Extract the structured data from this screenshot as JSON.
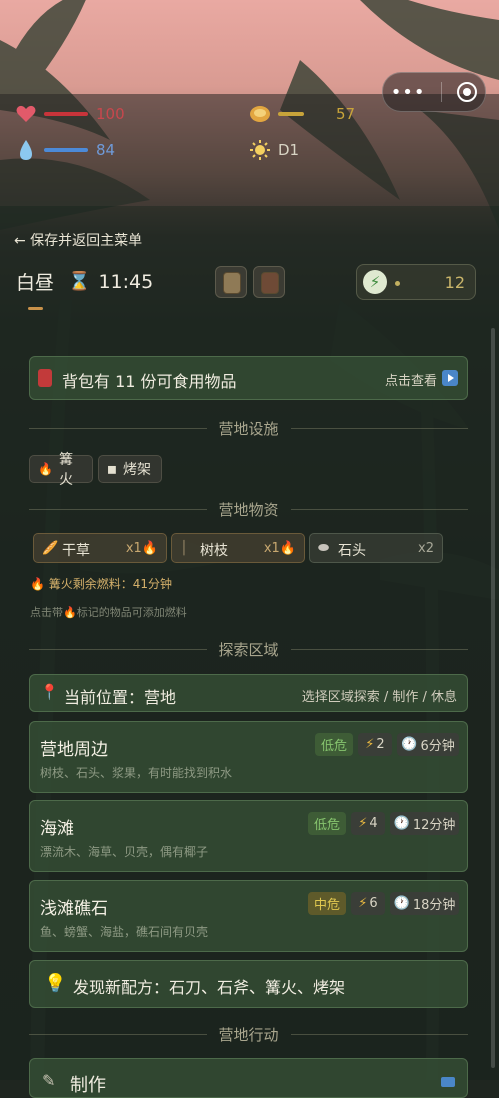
{
  "hud": {
    "health": {
      "icon": "heart-icon",
      "value": "100",
      "level": 1.0,
      "color": "#c8343a"
    },
    "water": {
      "icon": "water-drop-icon",
      "value": "84",
      "level": 0.84,
      "color": "#4c8ad8"
    },
    "food": {
      "icon": "bread-icon",
      "value": "57",
      "level": 0.57,
      "color": "#c8a43a"
    },
    "day": {
      "icon": "sun-icon",
      "value": "D1"
    }
  },
  "header": {
    "back_label": "← 保存并返回主菜单",
    "period": "白昼",
    "time": "11:45",
    "energy": "12"
  },
  "food_banner": {
    "text": "背包有 11 份可食用物品",
    "action": "点击查看"
  },
  "facilities": {
    "title": "营地设施",
    "items": [
      {
        "label": "篝火",
        "icon": "fire-icon"
      },
      {
        "label": "烤架",
        "icon": "grill-icon"
      }
    ]
  },
  "materials": {
    "title": "营地物资",
    "items": [
      {
        "name": "干草",
        "qty": "x1🔥",
        "icon": "hay-icon"
      },
      {
        "name": "树枝",
        "qty": "x1🔥",
        "icon": "stick-icon"
      },
      {
        "name": "石头",
        "qty": "x2",
        "icon": "stone-icon"
      }
    ],
    "fuel_note": "🔥 篝火剩余燃料：41分钟",
    "hint": "点击带🔥标记的物品可添加燃料"
  },
  "explore": {
    "title": "探索区域",
    "current_location": "当前位置：营地",
    "actions": "选择区域探索 / 制作 / 休息",
    "areas": [
      {
        "name": "营地周边",
        "risk": "低危",
        "energy": "2",
        "time": "6分钟",
        "desc": "树枝、石头、浆果，有时能找到积水"
      },
      {
        "name": "海滩",
        "risk": "低危",
        "energy": "4",
        "time": "12分钟",
        "desc": "漂流木、海草、贝壳，偶有椰子"
      },
      {
        "name": "浅滩礁石",
        "risk": "中危",
        "energy": "6",
        "time": "18分钟",
        "desc": "鱼、螃蟹、海盐，礁石间有贝壳"
      }
    ]
  },
  "recipes": {
    "text": "发现新配方：石刀、石斧、篝火、烤架"
  },
  "camp_actions": {
    "title": "营地行动",
    "first_action": "制作"
  }
}
